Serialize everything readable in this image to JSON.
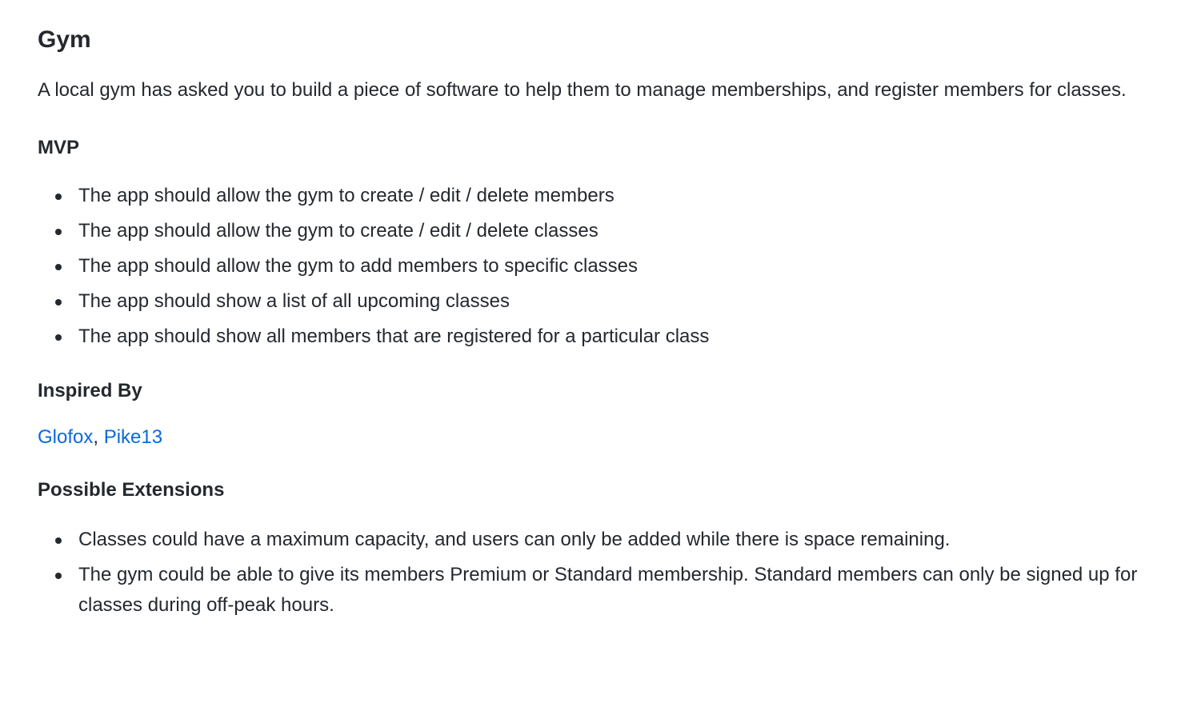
{
  "title": "Gym",
  "intro": "A local gym has asked you to build a piece of software to help them to manage memberships, and register members for classes.",
  "mvp": {
    "heading": "MVP",
    "items": [
      "The app should allow the gym to create / edit / delete members",
      "The app should allow the gym to create / edit / delete classes",
      "The app should allow the gym to add members to specific classes",
      "The app should show a list of all upcoming classes",
      "The app should show all members that are registered for a particular class"
    ]
  },
  "inspired": {
    "heading": "Inspired By",
    "links": [
      "Glofox",
      "Pike13"
    ],
    "separator": ", "
  },
  "extensions": {
    "heading": "Possible Extensions",
    "items": [
      "Classes could have a maximum capacity, and users can only be added while there is space remaining.",
      "The gym could be able to give its members Premium or Standard membership. Standard members can only be signed up for classes during off-peak hours."
    ]
  },
  "colors": {
    "text": "#24292f",
    "link": "#0969da",
    "background": "#ffffff"
  }
}
